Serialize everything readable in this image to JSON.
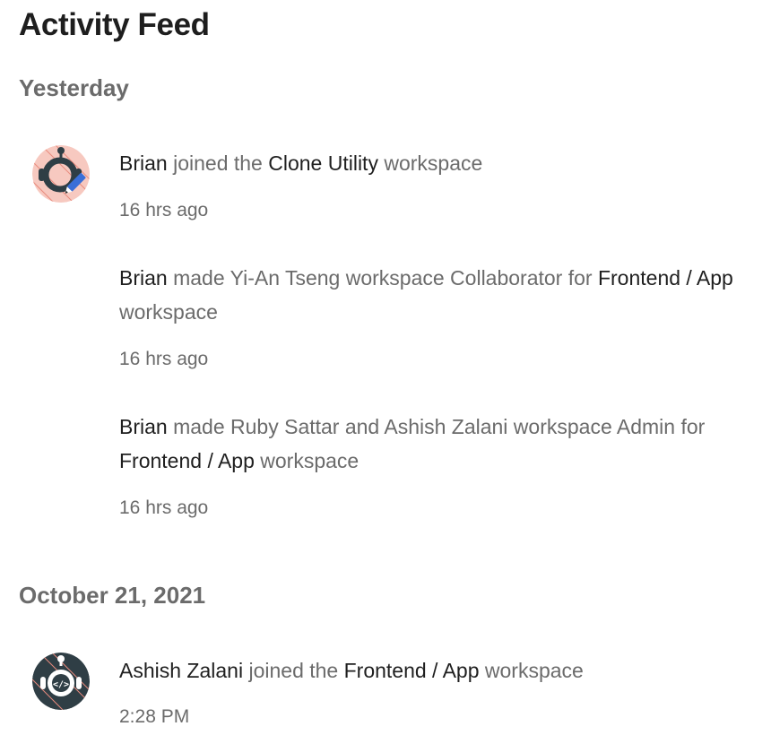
{
  "page": {
    "title": "Activity Feed"
  },
  "sections": [
    {
      "title": "Yesterday",
      "entries": [
        {
          "parts": [
            {
              "text": "Brian",
              "strong": true
            },
            {
              "text": " joined the ",
              "strong": false
            },
            {
              "text": "Clone Utility",
              "strong": true
            },
            {
              "text": " workspace",
              "strong": false
            }
          ],
          "time": "16 hrs ago",
          "avatar": "robot-pencil-icon"
        },
        {
          "parts": [
            {
              "text": "Brian",
              "strong": true
            },
            {
              "text": " made Yi-An Tseng workspace Collaborator for ",
              "strong": false
            },
            {
              "text": "Frontend / App",
              "strong": true
            },
            {
              "text": " workspace",
              "strong": false
            }
          ],
          "time": "16 hrs ago"
        },
        {
          "parts": [
            {
              "text": "Brian",
              "strong": true
            },
            {
              "text": " made Ruby Sattar and Ashish Zalani workspace Admin for ",
              "strong": false
            },
            {
              "text": "Frontend / App",
              "strong": true
            },
            {
              "text": " workspace",
              "strong": false
            }
          ],
          "time": "16 hrs ago"
        }
      ]
    },
    {
      "title": "October 21, 2021",
      "entries": [
        {
          "parts": [
            {
              "text": "Ashish Zalani",
              "strong": true
            },
            {
              "text": " joined the ",
              "strong": false
            },
            {
              "text": "Frontend / App",
              "strong": true
            },
            {
              "text": " workspace",
              "strong": false
            }
          ],
          "time": "2:28 PM",
          "avatar": "robot-code-icon"
        }
      ]
    }
  ],
  "colors": {
    "heading": "#1e1e1e",
    "muted": "#6b6b6b",
    "avatar_pink_bg": "#f7c9c0",
    "avatar_dark_bg": "#2f3e45",
    "pencil_blue": "#3a6fd8"
  }
}
